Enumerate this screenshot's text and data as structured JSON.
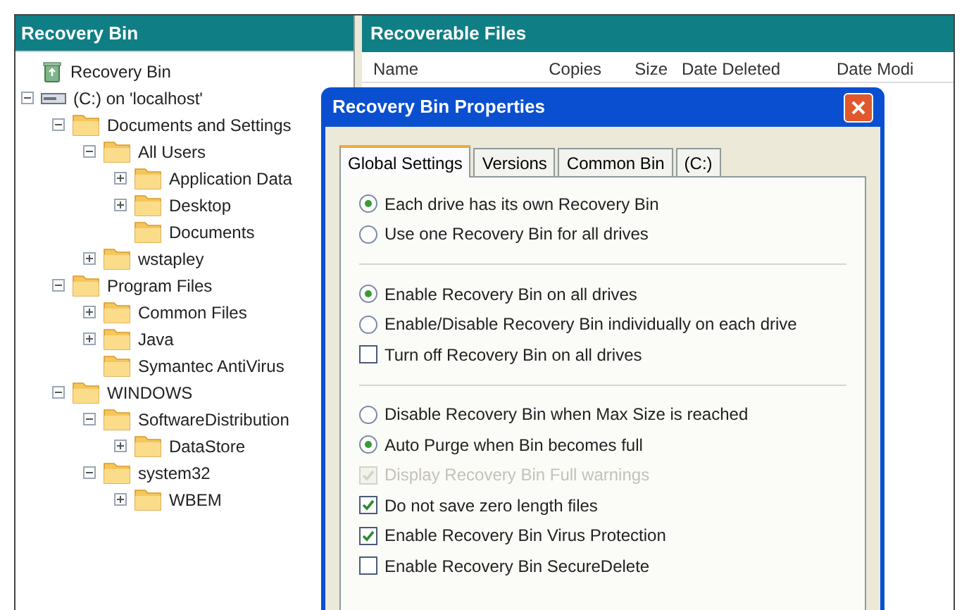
{
  "left_pane": {
    "title": "Recovery Bin",
    "tree": [
      {
        "label": "Recovery Bin",
        "kind": "bin"
      },
      {
        "label": "(C:) on 'localhost'",
        "kind": "drive",
        "expanded": true,
        "children": [
          {
            "label": "Documents and Settings",
            "kind": "folder",
            "expanded": true,
            "children": [
              {
                "label": "All Users",
                "kind": "folder",
                "expanded": true,
                "children": [
                  {
                    "label": "Application Data",
                    "kind": "folder",
                    "expanded": false
                  },
                  {
                    "label": "Desktop",
                    "kind": "folder",
                    "expanded": false
                  },
                  {
                    "label": "Documents",
                    "kind": "folder"
                  }
                ]
              },
              {
                "label": "wstapley",
                "kind": "folder",
                "expanded": false
              }
            ]
          },
          {
            "label": "Program Files",
            "kind": "folder",
            "expanded": true,
            "children": [
              {
                "label": "Common Files",
                "kind": "folder",
                "expanded": false
              },
              {
                "label": "Java",
                "kind": "folder",
                "expanded": false
              },
              {
                "label": "Symantec AntiVirus",
                "kind": "folder"
              }
            ]
          },
          {
            "label": "WINDOWS",
            "kind": "folder",
            "expanded": true,
            "children": [
              {
                "label": "SoftwareDistribution",
                "kind": "folder",
                "expanded": true,
                "children": [
                  {
                    "label": "DataStore",
                    "kind": "folder",
                    "expanded": false
                  }
                ]
              },
              {
                "label": "system32",
                "kind": "folder",
                "expanded": true,
                "children": [
                  {
                    "label": "WBEM",
                    "kind": "folder",
                    "expanded": false
                  }
                ]
              }
            ]
          }
        ]
      }
    ]
  },
  "right_pane": {
    "title": "Recoverable Files",
    "columns": [
      "Name",
      "Copies",
      "Size",
      "Date Deleted",
      "Date Modi"
    ]
  },
  "dialog": {
    "title": "Recovery Bin Properties",
    "tabs": [
      {
        "label": "Global Settings",
        "selected": true
      },
      {
        "label": "Versions",
        "selected": false
      },
      {
        "label": "Common Bin",
        "selected": false
      },
      {
        "label": "(C:)",
        "selected": false
      }
    ],
    "groups": [
      [
        {
          "kind": "radio",
          "label": "Each drive has its own Recovery Bin",
          "checked": true,
          "disabled": false
        },
        {
          "kind": "radio",
          "label": "Use one Recovery Bin for all drives",
          "checked": false,
          "disabled": false
        }
      ],
      [
        {
          "kind": "radio",
          "label": "Enable Recovery Bin on all drives",
          "checked": true,
          "disabled": false
        },
        {
          "kind": "radio",
          "label": "Enable/Disable Recovery Bin individually on each drive",
          "checked": false,
          "disabled": false
        },
        {
          "kind": "checkbox",
          "label": "Turn off Recovery Bin on all drives",
          "checked": false,
          "disabled": false
        }
      ],
      [
        {
          "kind": "radio",
          "label": "Disable Recovery Bin when Max Size is reached",
          "checked": false,
          "disabled": false
        },
        {
          "kind": "radio",
          "label": "Auto Purge when Bin becomes full",
          "checked": true,
          "disabled": false
        },
        {
          "kind": "checkbox",
          "label": "Display Recovery Bin Full warnings",
          "checked": true,
          "disabled": true
        },
        {
          "kind": "checkbox",
          "label": "Do not save zero length files",
          "checked": true,
          "disabled": false
        },
        {
          "kind": "checkbox",
          "label": "Enable Recovery Bin Virus Protection",
          "checked": true,
          "disabled": false
        },
        {
          "kind": "checkbox",
          "label": "Enable Recovery Bin SecureDelete",
          "checked": false,
          "disabled": false
        }
      ]
    ]
  }
}
